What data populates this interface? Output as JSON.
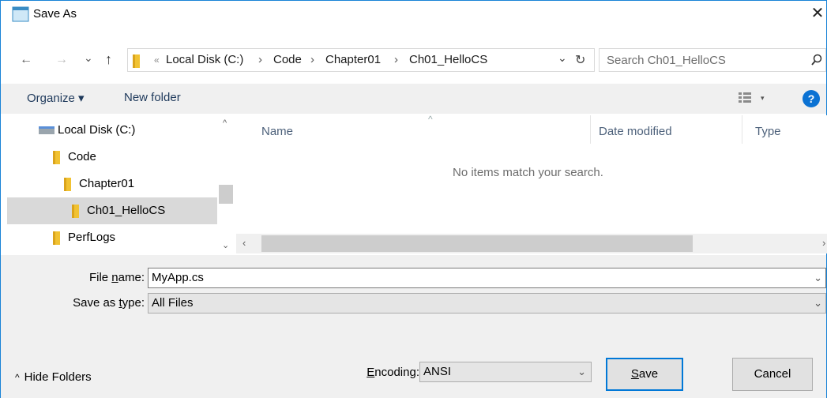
{
  "window": {
    "title": "Save As",
    "accent": "#1883d7"
  },
  "nav": {
    "back": "←",
    "forward": "→",
    "recent": "⌄",
    "up": "↑",
    "overflow": "«",
    "breadcrumbs": [
      "Local Disk (C:)",
      "Code",
      "Chapter01",
      "Ch01_HelloCS"
    ],
    "sep": "›",
    "dropdown": "⌄",
    "refresh": "↻"
  },
  "search": {
    "placeholder": "Search Ch01_HelloCS"
  },
  "toolbar": {
    "organize": "Organize ▾",
    "new_folder": "New folder",
    "help": "?"
  },
  "tree": [
    {
      "label": "Local Disk (C:)",
      "icon": "drive-icon"
    },
    {
      "label": "Code",
      "icon": "folder-icon"
    },
    {
      "label": "Chapter01",
      "icon": "folder-icon"
    },
    {
      "label": "Ch01_HelloCS",
      "icon": "folder-icon",
      "selected": true
    },
    {
      "label": "PerfLogs",
      "icon": "folder-icon"
    }
  ],
  "columns": {
    "name": "Name",
    "date": "Date modified",
    "type": "Type",
    "sort_arrow": "^"
  },
  "empty_message": "No items match your search.",
  "form": {
    "filename_label_pre": "File ",
    "filename_label_u": "n",
    "filename_label_post": "ame:",
    "filename_value": "MyApp.cs",
    "savetype_label_pre": "Save as ",
    "savetype_label_u": "t",
    "savetype_label_post": "ype:",
    "savetype_value": "All Files",
    "encoding_label_u": "E",
    "encoding_label_post": "ncoding:",
    "encoding_value": "ANSI"
  },
  "footer": {
    "hide_folders": "Hide Folders",
    "hide_arrow": "^",
    "save_u": "S",
    "save_post": "ave",
    "cancel": "Cancel"
  }
}
